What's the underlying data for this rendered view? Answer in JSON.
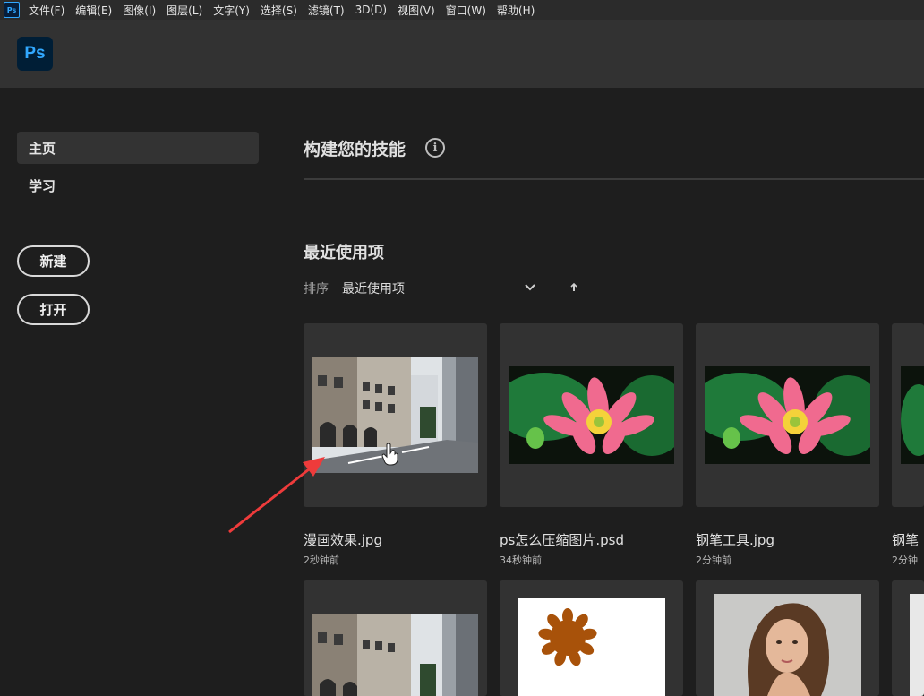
{
  "menubar": {
    "app_icon": "Ps",
    "items": [
      "文件(F)",
      "编辑(E)",
      "图像(I)",
      "图层(L)",
      "文字(Y)",
      "选择(S)",
      "滤镜(T)",
      "3D(D)",
      "视图(V)",
      "窗口(W)",
      "帮助(H)"
    ]
  },
  "header": {
    "logo": "Ps"
  },
  "sidebar": {
    "items": [
      {
        "label": "主页",
        "active": true
      },
      {
        "label": "学习",
        "active": false
      }
    ],
    "new_button": "新建",
    "open_button": "打开"
  },
  "main": {
    "skills_title": "构建您的技能",
    "info_icon": "i",
    "recent_title": "最近使用项",
    "sort_label": "排序",
    "sort_value": "最近使用项",
    "sort_chevron_icon": "chevron-down-icon",
    "sort_direction_icon": "arrow-up-icon"
  },
  "recent_files": [
    {
      "name": "漫画效果.jpg",
      "time": "2秒钟前",
      "thumb": "street"
    },
    {
      "name": "ps怎么压缩图片.psd",
      "time": "34秒钟前",
      "thumb": "lotus"
    },
    {
      "name": "钢笔工具.jpg",
      "time": "2分钟前",
      "thumb": "lotus"
    },
    {
      "name": "钢笔",
      "time": "2分钟",
      "thumb": "partial"
    }
  ],
  "recent_files_row2": [
    {
      "thumb": "street"
    },
    {
      "thumb": "flower-shape"
    },
    {
      "thumb": "portrait"
    },
    {
      "thumb": "partial"
    }
  ],
  "colors": {
    "background": "#1e1e1e",
    "header": "#323232",
    "menubar": "#2b2b2b",
    "card": "#323232",
    "accent": "#31a8ff",
    "annotation_arrow": "#ee3b3b"
  }
}
